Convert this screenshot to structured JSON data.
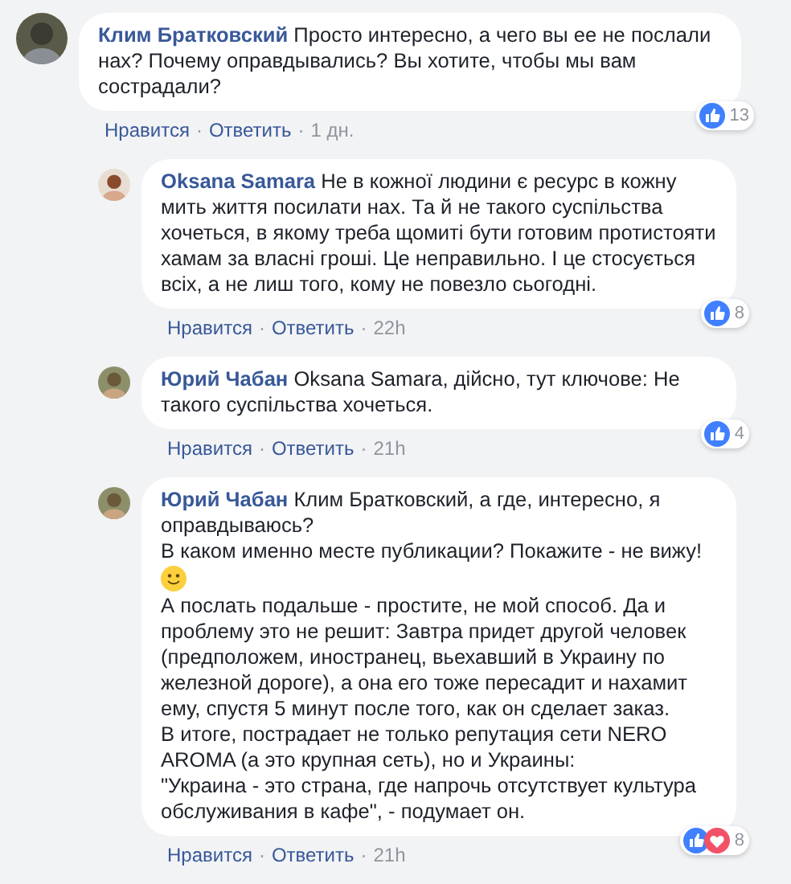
{
  "comments": [
    {
      "author": "Клим Братковский",
      "reply": false,
      "lines": [
        {
          "kind": "text",
          "text": "Просто интересно, а чего вы ее не послали нах? Почему оправдывались? Вы хотите, чтобы мы вам сострадали?"
        }
      ],
      "reactions": [
        {
          "kind": "like"
        }
      ],
      "count": "13",
      "meta": [
        {
          "kind": "link",
          "text": "Нравится"
        },
        {
          "kind": "dot",
          "text": "·"
        },
        {
          "kind": "link",
          "text": "Ответить"
        },
        {
          "kind": "dot",
          "text": "·"
        },
        {
          "kind": "time",
          "text": "1 дн."
        }
      ]
    },
    {
      "author": "Oksana Samara",
      "reply": true,
      "lines": [
        {
          "kind": "text",
          "text": "Не в кожної людини є ресурс в кожну мить життя посилати нах. Та й не такого суспільства хочеться, в якому треба щомиті бути готовим протистояти хамам за власні гроші. Це неправильно. І це стосується всіх, а не лиш того, кому не повезло сьогодні."
        }
      ],
      "reactions": [
        {
          "kind": "like"
        }
      ],
      "count": "8",
      "meta": [
        {
          "kind": "link",
          "text": "Нравится"
        },
        {
          "kind": "dot",
          "text": "·"
        },
        {
          "kind": "link",
          "text": "Ответить"
        },
        {
          "kind": "dot",
          "text": "·"
        },
        {
          "kind": "time",
          "text": "22h"
        }
      ]
    },
    {
      "author": "Юрий Чабан",
      "reply": true,
      "lines": [
        {
          "kind": "text",
          "text": "Oksana Samara, дійсно, тут ключове: Не такого суспільства хочеться."
        }
      ],
      "reactions": [
        {
          "kind": "like"
        }
      ],
      "count": "4",
      "meta": [
        {
          "kind": "link",
          "text": "Нравится"
        },
        {
          "kind": "dot",
          "text": "·"
        },
        {
          "kind": "link",
          "text": "Ответить"
        },
        {
          "kind": "dot",
          "text": "·"
        },
        {
          "kind": "time",
          "text": "21h"
        }
      ]
    },
    {
      "author": "Юрий Чабан",
      "reply": true,
      "lines": [
        {
          "kind": "text",
          "text": "Клим Братковский, а где, интересно, я оправдываюсь?"
        },
        {
          "kind": "text",
          "text": "В каком именно месте публикации? Покажите - не вижу!"
        },
        {
          "kind": "emoji"
        },
        {
          "kind": "text",
          "text": "А послать подальше - простите, не мой способ. Да и проблему это не решит: Завтра придет другой человек (предположем, иностранец, вьехавший в Украину по железной дороге), а она его тоже пересадит и нахамит ему, спустя 5 минут после того, как он сделает заказ."
        },
        {
          "kind": "text",
          "text": "В итоге, пострадает не только репутация сети NERO AROMA (а это крупная сеть), но и Украины:"
        },
        {
          "kind": "text",
          "text": "\"Украина - это страна, где напрочь отсутствует культура обслуживания в кафе\", - подумает он."
        }
      ],
      "reactions": [
        {
          "kind": "like"
        },
        {
          "kind": "love"
        }
      ],
      "count": "8",
      "meta": [
        {
          "kind": "link",
          "text": "Нравится"
        },
        {
          "kind": "dot",
          "text": "·"
        },
        {
          "kind": "link",
          "text": "Ответить"
        },
        {
          "kind": "dot",
          "text": "·"
        },
        {
          "kind": "time",
          "text": "21h"
        }
      ]
    }
  ]
}
